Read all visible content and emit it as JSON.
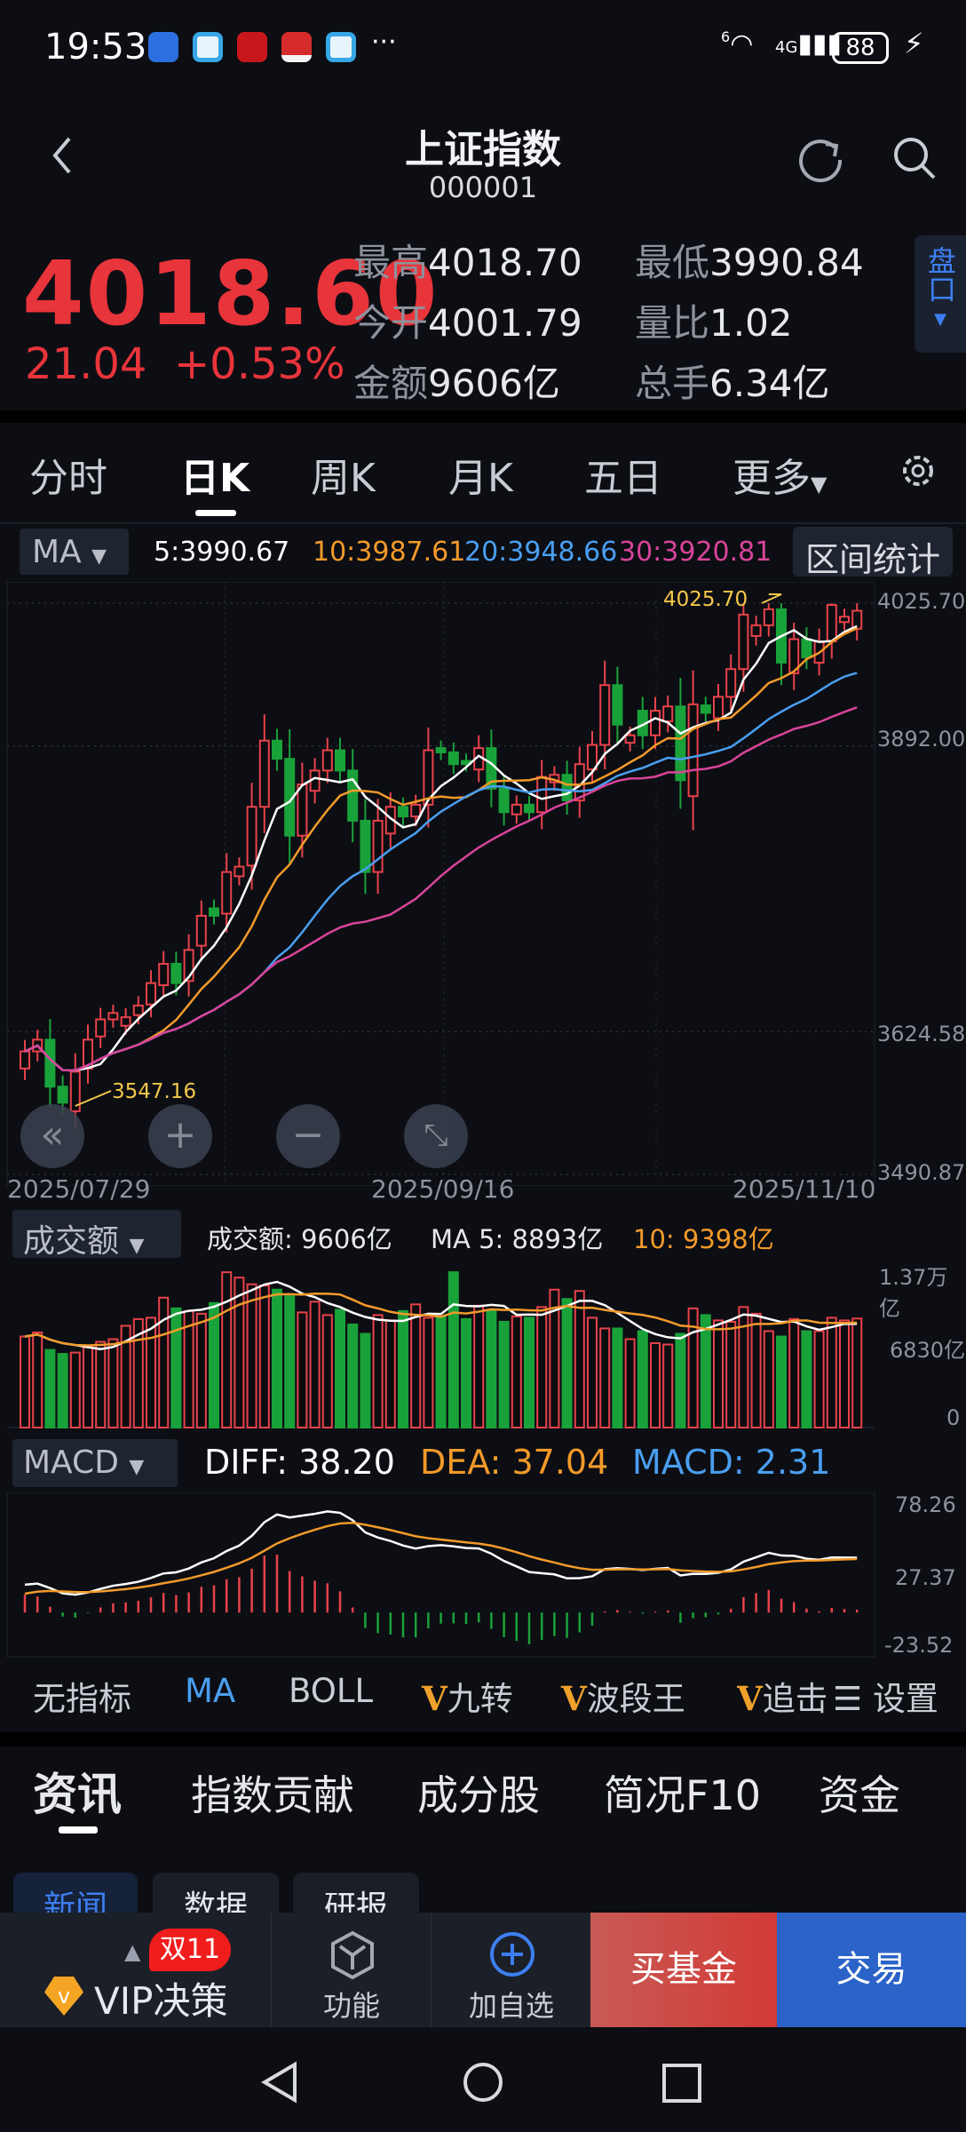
{
  "status_bar": {
    "time": "19:53",
    "more": "···",
    "wifi_label": "6",
    "network": "4G",
    "battery": "88"
  },
  "header": {
    "title": "上证指数",
    "code": "000001"
  },
  "quote": {
    "price": "4018.60",
    "change": "21.04",
    "change_pct": "+0.53%",
    "stats": [
      {
        "label": "最高",
        "value": "4018.70"
      },
      {
        "label": "最低",
        "value": "3990.84"
      },
      {
        "label": "今开",
        "value": "4001.79"
      },
      {
        "label": "量比",
        "value": "1.02"
      },
      {
        "label": "金额",
        "value": "9606亿"
      },
      {
        "label": "总手",
        "value": "6.34亿"
      }
    ],
    "pankou": "盘口"
  },
  "tabs": [
    "分时",
    "日K",
    "周K",
    "月K",
    "五日",
    "更多"
  ],
  "ma_bar": {
    "selector": "MA",
    "ma5": "5:3990.67",
    "ma10": "10:3987.61",
    "ma20": "20:3948.66",
    "ma30": "30:3920.81",
    "range_stats": "区间统计"
  },
  "colors": {
    "up": "#e8424a",
    "down": "#1aa23a",
    "ma5": "#ffffff",
    "ma10": "#f39a2a",
    "ma20": "#4a9ef0",
    "ma30": "#d9449a",
    "accent": "#3d7ff0"
  },
  "chart_data": [
    {
      "type": "candlestick",
      "ylim": [
        3490.87,
        4025.7
      ],
      "y_ticks": [
        "4025.70",
        "3892.00",
        "3624.58",
        "3490.87"
      ],
      "x_labels": [
        "2025/07/29",
        "2025/09/16",
        "2025/11/10"
      ],
      "max_label": "4025.70",
      "min_label": "3547.16",
      "open": [
        3590,
        3606,
        3617,
        3573,
        3550,
        3590,
        3620,
        3636,
        3630,
        3640,
        3650,
        3668,
        3688,
        3672,
        3705,
        3740,
        3735,
        3770,
        3780,
        3835,
        3897,
        3880,
        3808,
        3850,
        3869,
        3888,
        3869,
        3822,
        3774,
        3810,
        3835,
        3826,
        3837,
        3890,
        3886,
        3878,
        3870,
        3890,
        3852,
        3828,
        3837,
        3830,
        3858,
        3865,
        3841,
        3870,
        3893,
        3949,
        3895,
        3925,
        3902,
        3915,
        3929,
        3845,
        3930,
        3918,
        3938,
        3964,
        3995,
        4005,
        4020,
        3960,
        3992,
        3970,
        3990,
        4008,
        4001.79
      ],
      "close": [
        3606,
        3617,
        3573,
        3558,
        3587,
        3617,
        3636,
        3642,
        3638,
        3649,
        3670,
        3688,
        3670,
        3701,
        3733,
        3733,
        3774,
        3779,
        3835,
        3897,
        3880,
        3808,
        3856,
        3869,
        3888,
        3869,
        3822,
        3774,
        3822,
        3835,
        3826,
        3837,
        3888,
        3886,
        3875,
        3875,
        3890,
        3852,
        3830,
        3837,
        3830,
        3863,
        3865,
        3841,
        3875,
        3893,
        3949,
        3912,
        3902,
        3902,
        3925,
        3929,
        3860,
        3931,
        3923,
        3938,
        3964,
        4015,
        4005,
        4020,
        3970,
        3992,
        3975,
        3990,
        4024,
        4013,
        4018.6
      ]
    },
    {
      "type": "bar",
      "title": "成交额",
      "unit": "亿",
      "y_ticks": [
        "1.37万亿",
        "6830亿",
        "0"
      ],
      "ylim": [
        0,
        13700
      ],
      "values": [
        8024,
        8378,
        6844,
        6490,
        6608,
        7080,
        7552,
        7788,
        8968,
        9558,
        9676,
        11446,
        10502,
        10266,
        10030,
        10974,
        13688,
        13216,
        12626,
        12508,
        12154,
        11564,
        10148,
        11092,
        9912,
        10384,
        9086,
        8260,
        9912,
        9440,
        10266,
        10856,
        9676,
        9794,
        13688,
        9558,
        10738,
        10266,
        9322,
        9794,
        9676,
        10620,
        12154,
        11328,
        12036,
        9676,
        8732,
        8732,
        7788,
        8496,
        7434,
        7316,
        8260,
        10502,
        9912,
        9440,
        9322,
        10620,
        10030,
        8496,
        8024,
        9558,
        8496,
        8496,
        9676,
        9440,
        9606
      ],
      "legend": {
        "value": "成交额: 9606亿",
        "ma5": "MA 5: 8893亿",
        "ma10": "10: 9398亿"
      }
    },
    {
      "type": "line",
      "title": "MACD",
      "ylim": [
        -23.52,
        78.26
      ],
      "y_ticks": [
        "78.26",
        "27.37",
        "-23.52"
      ],
      "legend": {
        "diff": "DIFF: 38.20",
        "dea": "DEA: 37.04",
        "macd": "MACD: 2.31"
      }
    }
  ],
  "volume_selector": "成交额",
  "macd_selector": "MACD",
  "indicators": [
    "无指标",
    "MA",
    "BOLL",
    "九转",
    "波段王",
    "追击",
    "设置"
  ],
  "vip_mark": "V",
  "bottom_tabs": [
    "资讯",
    "指数贡献",
    "成分股",
    "简况F10",
    "资金"
  ],
  "sub_tabs": [
    "新闻",
    "数据",
    "研报"
  ],
  "action_bar": {
    "vip": "VIP决策",
    "badge": "双11",
    "func": "功能",
    "add": "加自选",
    "buy_fund": "买基金",
    "trade": "交易"
  }
}
